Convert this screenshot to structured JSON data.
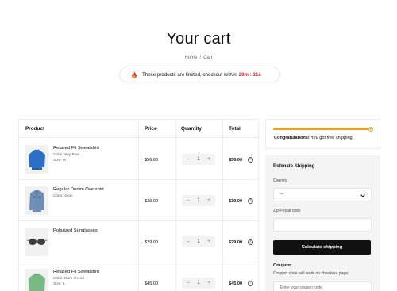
{
  "header": {
    "title": "Your cart",
    "breadcrumb": [
      "Home",
      "/",
      "Cart"
    ]
  },
  "urgency": {
    "icon": "fire-icon",
    "message": "These products are limited, checkout within",
    "timer": "29m : 31s",
    "timer_color": "#d8262d"
  },
  "table": {
    "headers": {
      "product": "Product",
      "price": "Price",
      "quantity": "Quantity",
      "total": "Total"
    },
    "rows": [
      {
        "name": "Relaxed Fit Sweatshirt",
        "meta1": "Color: Sky Blue",
        "meta2": "Size: M",
        "price": "$56.00",
        "qty": "1",
        "total": "$56.00",
        "minus": "–",
        "plus": "+"
      },
      {
        "name": "Regular Denim Overshirt",
        "meta1": "Color: Jean",
        "meta2": "",
        "price": "$39.00",
        "qty": "1",
        "total": "$39.00",
        "minus": "–",
        "plus": "+"
      },
      {
        "name": "Polarized Sunglasses",
        "meta1": "",
        "meta2": "",
        "price": "$29.00",
        "qty": "1",
        "total": "$29.00",
        "minus": "–",
        "plus": "+"
      },
      {
        "name": "Relaxed Fit Sweatshirt",
        "meta1": "Color: Dark Green",
        "meta2": "Size: L",
        "price": "$45.00",
        "qty": "1",
        "total": "$45.00",
        "minus": "–",
        "plus": "+"
      }
    ]
  },
  "shipping_progress": {
    "progress": 1.0,
    "message_bold": "Congratulations!",
    "message": "You got free shipping",
    "accent": "#e9a32a"
  },
  "estimate": {
    "title": "Estimate Shipping",
    "country_label": "Country",
    "country_value": "--",
    "zip_label": "Zip/Postal code",
    "button": "Calculate shipping",
    "coupon_title": "Coupon:",
    "coupon_note": "Coupon code will work on checkout page",
    "coupon_placeholder": "Enter your coupon code"
  }
}
